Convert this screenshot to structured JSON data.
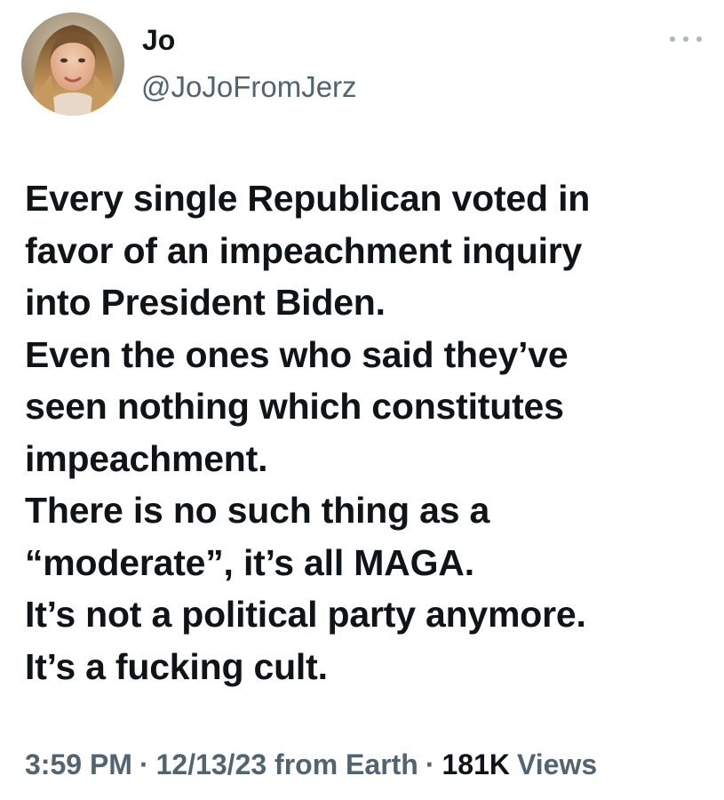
{
  "author": {
    "display_name": "Jo",
    "handle": "@JoJoFromJerz"
  },
  "tweet": {
    "lines": [
      "Every single Republican voted in",
      "favor of an impeachment inquiry",
      "into President Biden.",
      "Even the ones who said they’ve",
      "seen nothing which constitutes",
      "impeachment.",
      "There is no such thing as a",
      "“moderate”, it’s all MAGA.",
      "It’s not a political party anymore.",
      "It’s a fucking cult."
    ]
  },
  "meta": {
    "time": "3:59 PM",
    "date": "12/13/23",
    "source": "from Earth",
    "separator": "·",
    "views_count": "181K",
    "views_label": "Views"
  },
  "icons": {
    "more": "more-options-icon",
    "avatar": "profile-photo"
  },
  "colors": {
    "text_primary": "#0f1419",
    "text_secondary": "#536471",
    "background": "#ffffff"
  }
}
